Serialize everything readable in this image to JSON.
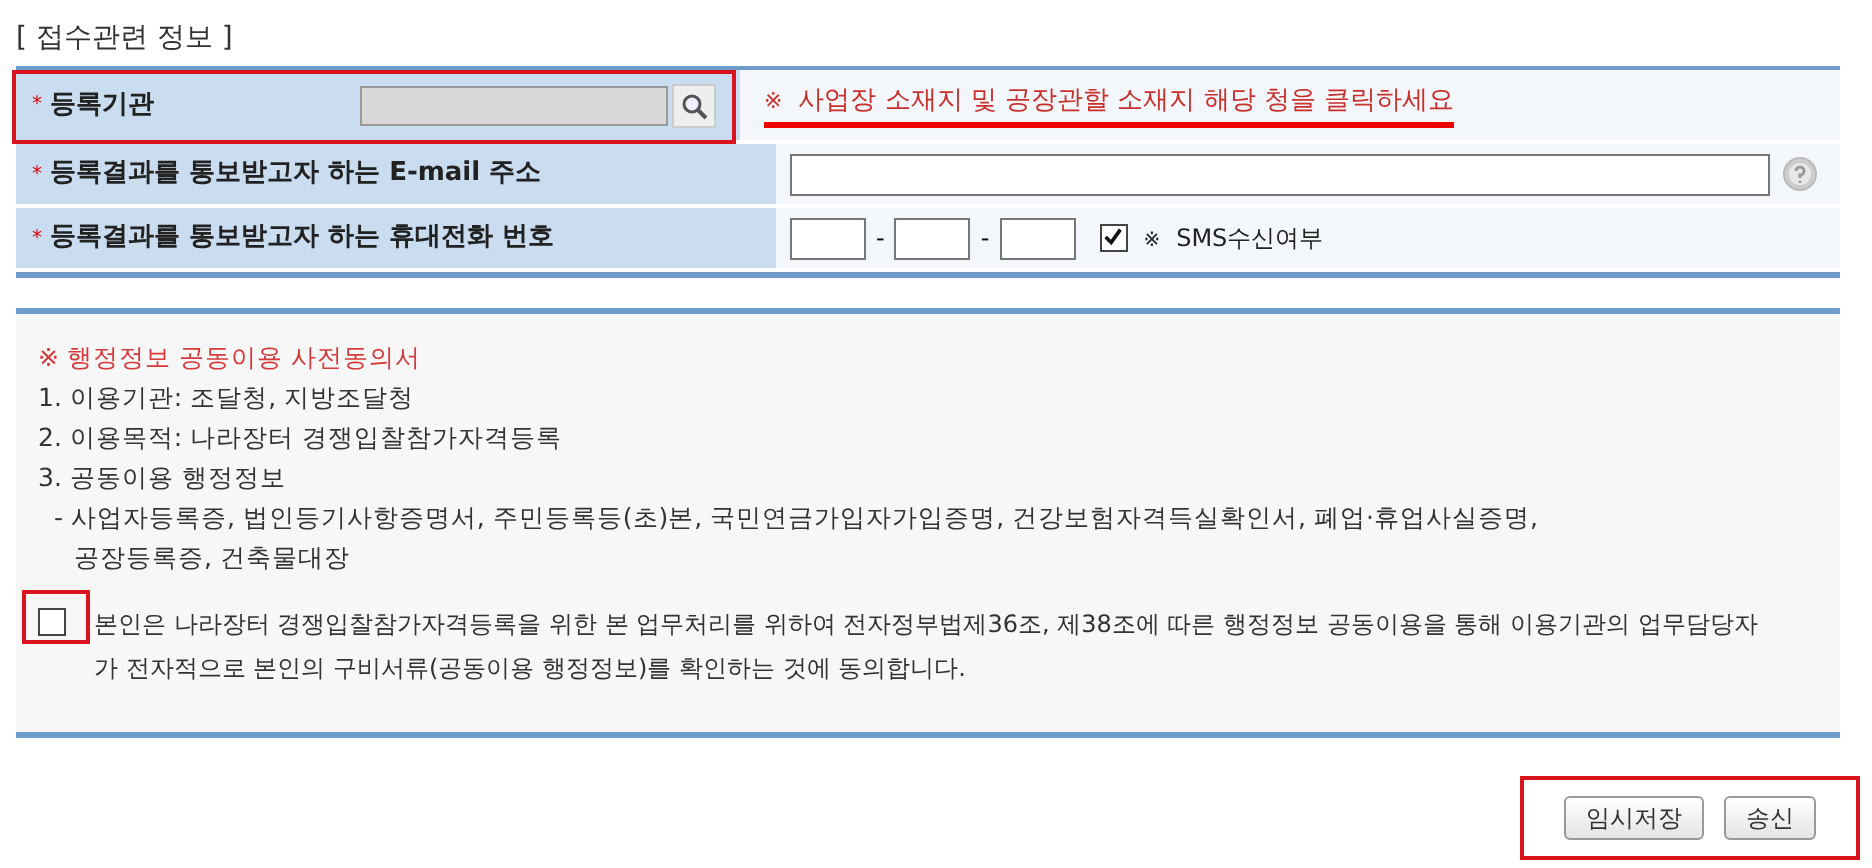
{
  "section_title": "[ 접수관련 정보 ]",
  "fields": [
    {
      "kind": "lookup",
      "required": true,
      "marker": "*",
      "label": "등록기관",
      "notice_mark": "※",
      "notice": "사업장 소재지 및 공장관할 소재지 해당 청을 클릭하세요"
    },
    {
      "kind": "email",
      "required": true,
      "marker": "*",
      "label": "등록결과를 통보받고자 하는 E-mail 주소"
    },
    {
      "kind": "phone",
      "required": true,
      "marker": "*",
      "label": "등록결과를 통보받고자 하는 휴대전화 번호",
      "separators": [
        "-",
        "-"
      ],
      "sms_mark": "※",
      "sms_label": "SMS수신여부",
      "sms_checked": true
    }
  ],
  "consent": {
    "title": "※ 행정정보 공동이용 사전동의서",
    "lines": [
      {
        "kind": "item",
        "text": "1. 이용기관: 조달청, 지방조달청"
      },
      {
        "kind": "item",
        "text": "2. 이용목적: 나라장터 경쟁입찰참가자격등록"
      },
      {
        "kind": "item",
        "text": "3. 공동이용 행정정보"
      },
      {
        "kind": "sub",
        "text": "- 사업자등록증, 법인등기사항증명서, 주민등록등(초)본, 국민연금가입자가입증명, 건강보험자격득실확인서, 폐업·휴업사실증명,"
      },
      {
        "kind": "cont",
        "text": "공장등록증, 건축물대장"
      }
    ],
    "agreement": "본인은 나라장터 경쟁입찰참가자격등록을 위한 본 업무처리를 위하여 전자정부법제36조, 제38조에 따른 행정정보 공동이용을 통해 이용기관의 업무담당자가 전자적으로 본인의 구비서류(공동이용 행정정보)를 확인하는 것에 동의합니다.",
    "checked": false
  },
  "buttons": [
    "임시저장",
    "송신"
  ]
}
